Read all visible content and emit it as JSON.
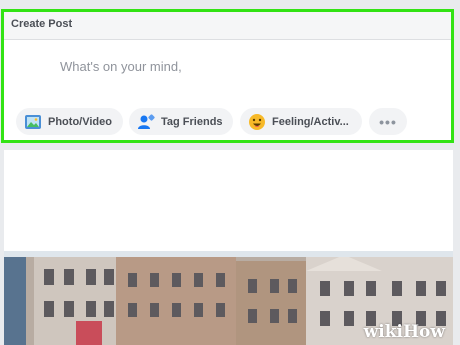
{
  "composer": {
    "title": "Create Post",
    "placeholder": "What's on your mind,",
    "highlight_color": "#32e314",
    "actions": [
      {
        "label": "Photo/Video",
        "icon": "photo-video-icon"
      },
      {
        "label": "Tag Friends",
        "icon": "tag-friends-icon"
      },
      {
        "label": "Feeling/Activ...",
        "icon": "feeling-emoji-icon"
      },
      {
        "label": "•••",
        "icon": "more-options-icon"
      }
    ]
  },
  "post": {
    "image": "street-building-photo"
  },
  "watermark": {
    "text": "wikiHow"
  }
}
